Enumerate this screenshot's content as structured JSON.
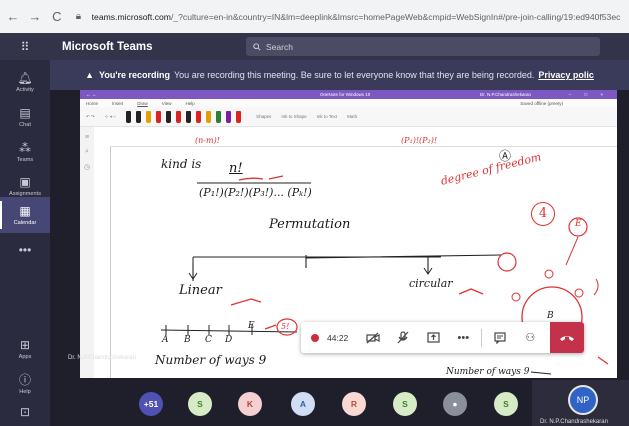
{
  "browser": {
    "back": "←",
    "forward": "→",
    "reload": "C",
    "url_domain": "teams.microsoft.com",
    "url_path": "/_?culture=en-in&country=IN&lm=deeplink&lmsrc=homePageWeb&cmpid=WebSignIn#/pre-join-calling/19:ed940f53ec"
  },
  "header": {
    "app_name": "Microsoft Teams",
    "search_placeholder": "Search"
  },
  "rail": [
    {
      "label": "Activity",
      "icon": "bell-icon"
    },
    {
      "label": "Chat",
      "icon": "chat-icon"
    },
    {
      "label": "Teams",
      "icon": "teams-icon"
    },
    {
      "label": "Assignments",
      "icon": "assignments-icon"
    },
    {
      "label": "Calendar",
      "icon": "calendar-icon",
      "active": true
    },
    {
      "label": "",
      "icon": "more-icon"
    },
    {
      "label": "Apps",
      "icon": "apps-icon"
    },
    {
      "label": "Help",
      "icon": "help-icon"
    },
    {
      "label": "",
      "icon": "download-icon"
    }
  ],
  "banner": {
    "bold": "You're recording",
    "message": "You are recording this meeting. Be sure to let everyone know that they are being recorded.",
    "link": "Privacy polic"
  },
  "onenote": {
    "title": "OneNote for Windows 10",
    "user": "Dr. N.P.Chandrashekaran",
    "window_controls": "–  □  ×",
    "menu": [
      "Home",
      "Insert",
      "Draw",
      "View",
      "Help"
    ],
    "menu_right": "Saved offline (preety)",
    "share": "Share",
    "tools": [
      "Shapes",
      "Ink to Shape",
      "Ink to Text",
      "Math"
    ]
  },
  "handwriting": {
    "top_fragment_1": "(n-m)!",
    "top_fragment_2": "(P₁)!(P₂)!",
    "kind_is": "kind is",
    "n_fact": "n!",
    "denominator": "(P₁!)(P₂!)(P₃!)... (Pₖ!)",
    "circled_a": "Ⓐ",
    "degree_note": "degree of freedom",
    "circled_4": "4",
    "circled_e": "E",
    "permutation": "Permutation",
    "linear": "Linear",
    "circular": "circular",
    "letters": [
      "A",
      "B",
      "C",
      "D",
      "E"
    ],
    "five_fact": "5!",
    "number_of_ways": "Number of ways 9",
    "circle_label_b": "B",
    "bottom_right": "Number of ways 9"
  },
  "call": {
    "timer": "44:22",
    "presenter": "Dr. N.P.Chandrashekaran"
  },
  "participants": [
    {
      "label": "+51",
      "color": "#4f52b2",
      "text": "#fff"
    },
    {
      "label": "S",
      "color": "#d7ecc6",
      "text": "#3f7e2a"
    },
    {
      "label": "K",
      "color": "#f5d0d0",
      "text": "#b2413b"
    },
    {
      "label": "A",
      "color": "#d0def5",
      "text": "#2f5fb5"
    },
    {
      "label": "R",
      "color": "#f9d9d3",
      "text": "#b85241"
    },
    {
      "label": "S",
      "color": "#d7ecc6",
      "text": "#3f7e2a"
    },
    {
      "label": "",
      "color": "#8a8f99",
      "text": "#fff"
    },
    {
      "label": "S",
      "color": "#d7ecc6",
      "text": "#3f7e2a"
    }
  ],
  "self": {
    "name": "Dr. N.P.Chandrashekaran",
    "initials": "NP"
  }
}
